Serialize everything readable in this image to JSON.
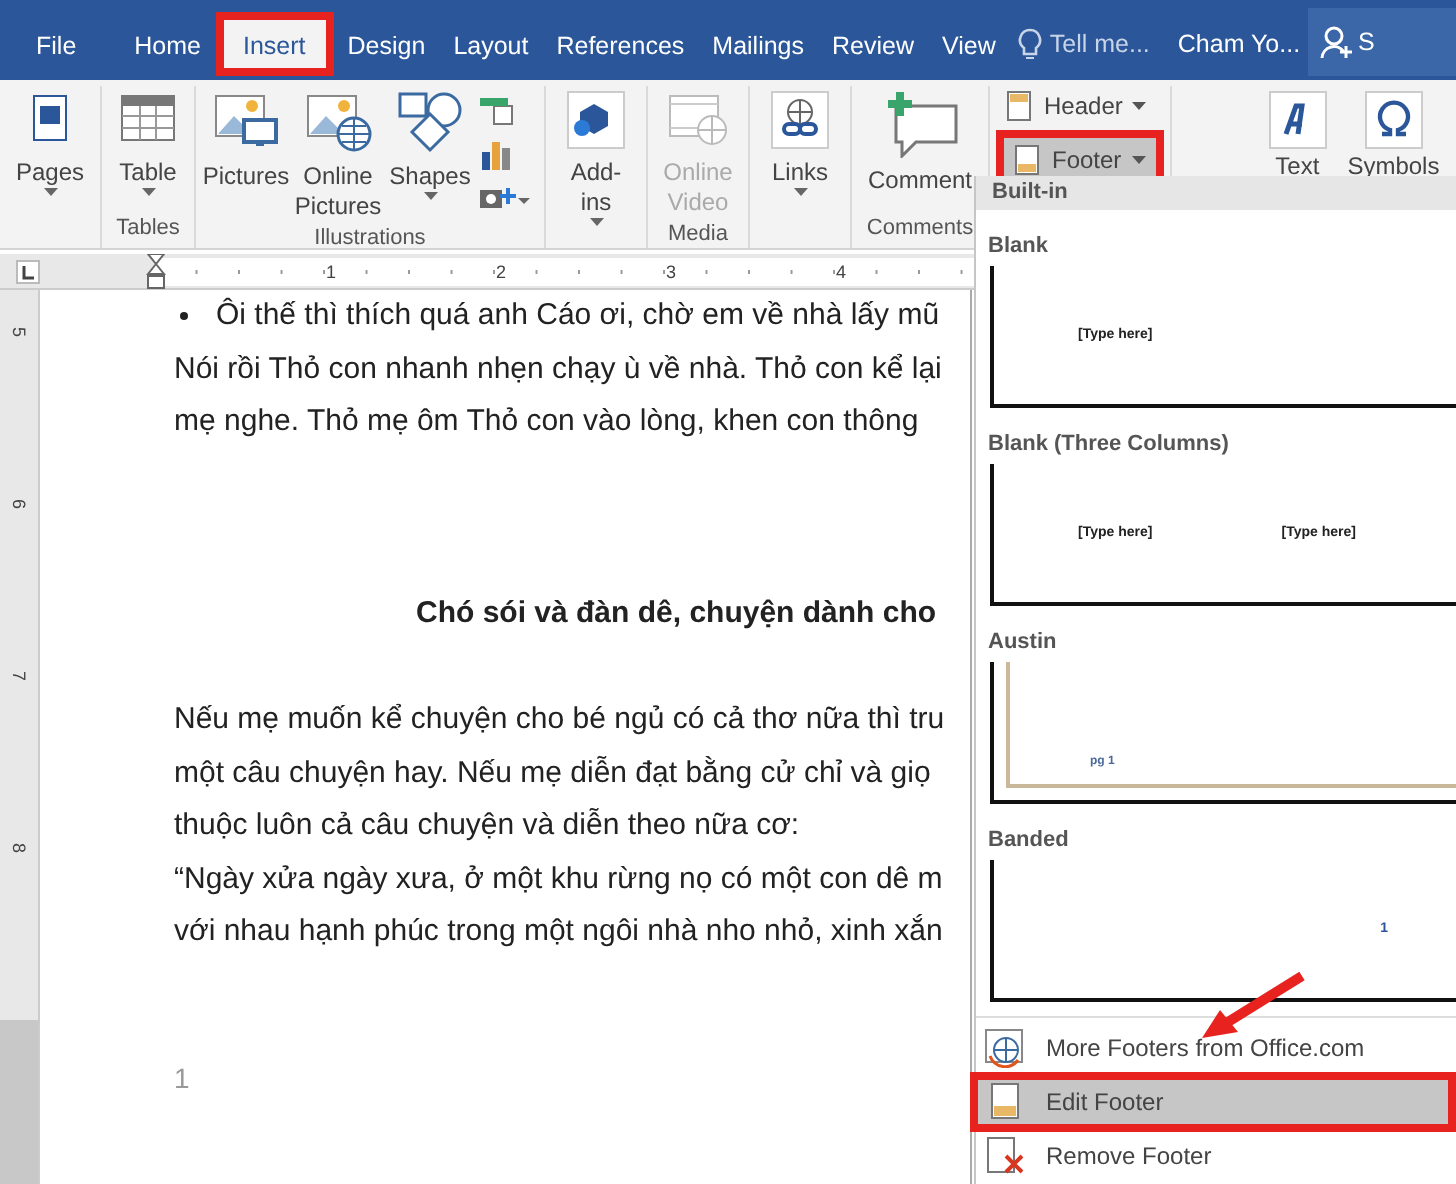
{
  "ribbon_tabs": [
    {
      "label": "File",
      "selected": false,
      "annotated": false
    },
    {
      "label": "Home",
      "selected": false,
      "annotated": false
    },
    {
      "label": "Insert",
      "selected": true,
      "annotated": true
    },
    {
      "label": "Design",
      "selected": false,
      "annotated": false
    },
    {
      "label": "Layout",
      "selected": false,
      "annotated": false
    },
    {
      "label": "References",
      "selected": false,
      "annotated": false
    },
    {
      "label": "Mailings",
      "selected": false,
      "annotated": false
    },
    {
      "label": "Review",
      "selected": false,
      "annotated": false
    },
    {
      "label": "View",
      "selected": false,
      "annotated": false
    }
  ],
  "tell_me": {
    "placeholder": "Tell me..."
  },
  "user": "Cham Yo...",
  "share": "S",
  "ribbon_groups": [
    {
      "buttons": [
        {
          "label": "Pages",
          "kind": "pages",
          "dropdown": true
        }
      ]
    },
    {
      "label": "Tables",
      "buttons": [
        {
          "label": "Table",
          "kind": "table",
          "dropdown": true
        }
      ]
    },
    {
      "label": "Illustrations",
      "buttons": [
        {
          "label": "Pictures",
          "kind": "pictures"
        },
        {
          "label": "Online Pictures",
          "kind": "online-pictures"
        },
        {
          "label": "Shapes",
          "kind": "shapes",
          "dropdown": true
        },
        {
          "kind": "mini-column"
        }
      ]
    },
    {
      "buttons": [
        {
          "label": "Add-ins",
          "kind": "addins",
          "dropdown": true
        }
      ]
    },
    {
      "label": "Media",
      "buttons": [
        {
          "label": "Online Video",
          "kind": "video",
          "disabled": true
        }
      ]
    },
    {
      "buttons": [
        {
          "label": "Links",
          "kind": "links",
          "dropdown": true
        }
      ]
    },
    {
      "label": "Comments",
      "buttons": [
        {
          "label": "Comment",
          "kind": "comment"
        }
      ]
    },
    {
      "buttons": [
        {
          "label": "Header",
          "kind": "header",
          "dropdown": true,
          "selected": false,
          "annotated": false
        },
        {
          "label": "Footer",
          "kind": "footer",
          "dropdown": true,
          "selected": true,
          "annotated": true
        }
      ]
    },
    {
      "buttons": [
        {
          "label": "Text",
          "kind": "text"
        },
        {
          "label": "Symbols",
          "kind": "symbols"
        }
      ]
    }
  ],
  "ruler": {
    "marks": [
      "1",
      "2",
      "3",
      "4"
    ]
  },
  "vertical_ruler": {
    "marks": [
      "5",
      "6",
      "7",
      "8"
    ]
  },
  "document": [
    {
      "kind": "bullet",
      "text": "Ôi thế thì thích quá anh Cáo ơi, chờ em về nhà lấy mũ"
    },
    {
      "kind": "body",
      "text": "Nói rồi Thỏ con nhanh nhẹn chạy ù về nhà. Thỏ con kể lại"
    },
    {
      "kind": "body",
      "text": "mẹ nghe. Thỏ mẹ ôm Thỏ con vào lòng, khen con thông"
    },
    {
      "kind": "heading",
      "text": "Chó sói và đàn dê, chuyện dành cho"
    },
    {
      "kind": "body",
      "text": "Nếu mẹ muốn kể chuyện cho bé ngủ có cả thơ nữa thì tru"
    },
    {
      "kind": "body",
      "text": "một câu chuyện hay. Nếu mẹ diễn đạt bằng cử chỉ và giọ"
    },
    {
      "kind": "body",
      "text": "thuộc luôn cả câu chuyện và diễn theo nữa cơ:"
    },
    {
      "kind": "body",
      "text": "“Ngày xửa ngày xưa, ở một khu rừng nọ có một con dê m"
    },
    {
      "kind": "body",
      "text": "với nhau hạnh phúc trong một ngôi nhà nho nhỏ, xinh xắn"
    }
  ],
  "page_number": "1",
  "footer_menu": {
    "section": "Built-in",
    "gallery": [
      {
        "name": "Blank",
        "kind": "blank",
        "texts": [
          "[Type here]"
        ]
      },
      {
        "name": "Blank (Three Columns)",
        "kind": "three",
        "texts": [
          "[Type here]",
          "[Type here]"
        ]
      },
      {
        "name": "Austin",
        "kind": "austin",
        "texts": [
          "pg 1"
        ]
      },
      {
        "name": "Banded",
        "kind": "banded",
        "texts": [
          "1"
        ]
      }
    ],
    "items": [
      {
        "label": "More Footers from Office.com",
        "kind": "more",
        "selected": false,
        "annotated": false
      },
      {
        "label": "Edit Footer",
        "kind": "edit",
        "selected": true,
        "annotated": true
      },
      {
        "label": "Remove Footer",
        "kind": "remove",
        "selected": false,
        "annotated": false
      }
    ]
  }
}
